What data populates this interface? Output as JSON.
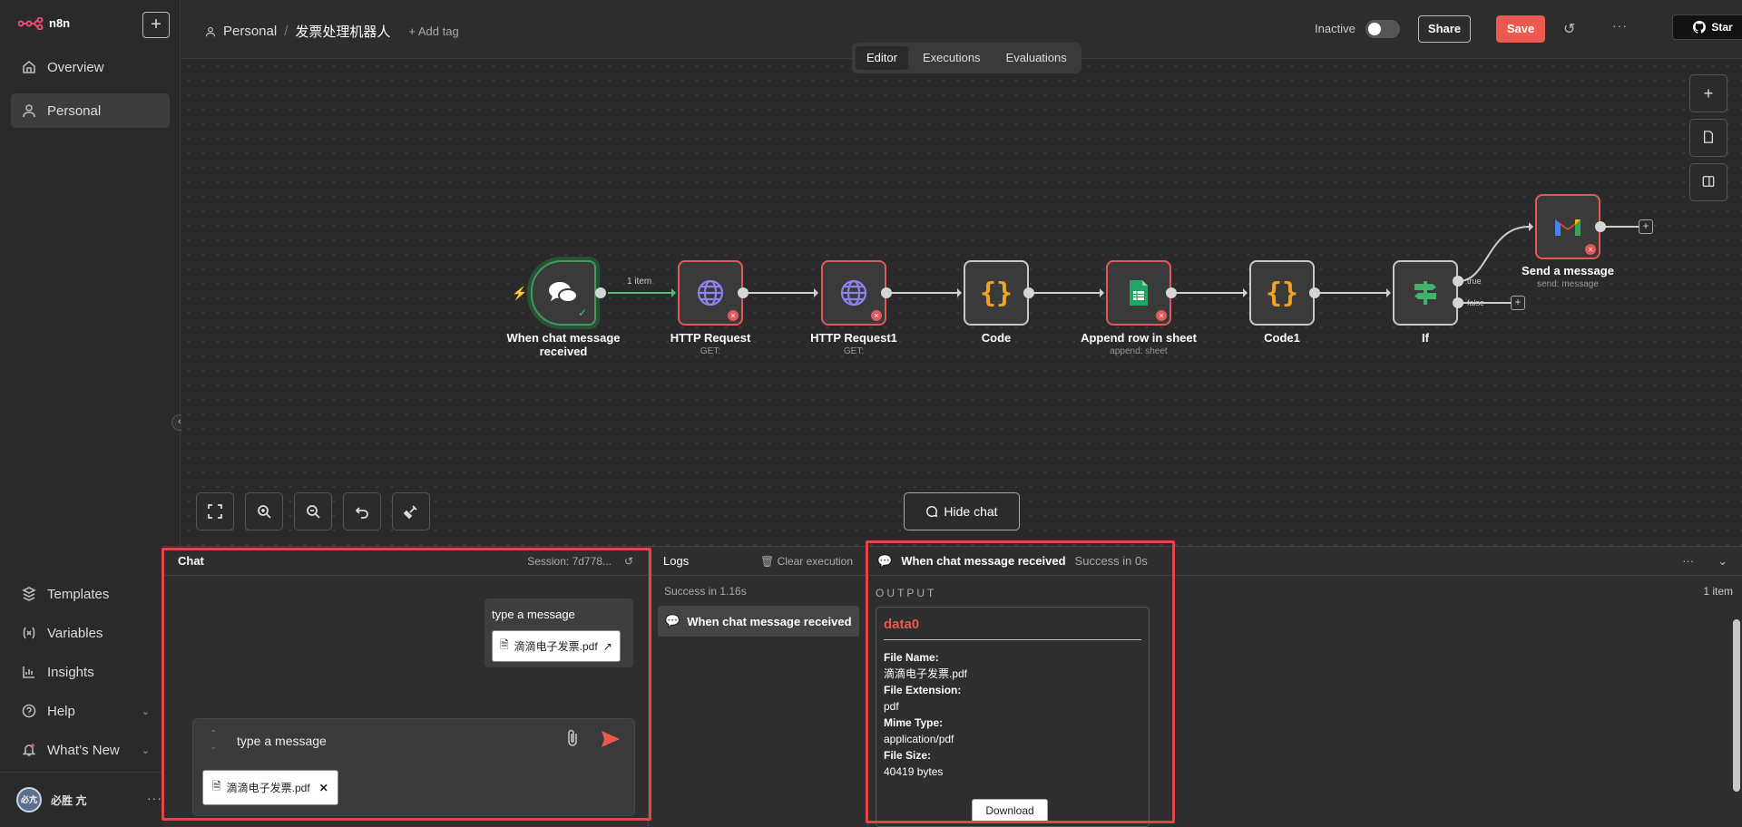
{
  "app": {
    "name": "n8n",
    "new_button": "+"
  },
  "sidebar": {
    "items": [
      {
        "label": "Overview",
        "icon": "home-icon"
      },
      {
        "label": "Personal",
        "icon": "user-icon"
      }
    ],
    "bottom_items": [
      {
        "label": "Templates",
        "icon": "templates-icon"
      },
      {
        "label": "Variables",
        "icon": "variables-icon"
      },
      {
        "label": "Insights",
        "icon": "insights-icon"
      },
      {
        "label": "Help",
        "icon": "help-icon"
      },
      {
        "label": "What’s New",
        "icon": "whats-new-icon"
      }
    ],
    "user": {
      "name": "必胜 亢",
      "avatar_text": "必亢"
    }
  },
  "header": {
    "project": "Personal",
    "workflow_name": "发票处理机器人",
    "add_tag": "+ Add tag",
    "status": "Inactive",
    "share": "Share",
    "save": "Save",
    "github": "Star"
  },
  "canvas": {
    "tabs": [
      "Editor",
      "Executions",
      "Evaluations"
    ],
    "active_tab": "Editor",
    "hide_chat": "Hide chat",
    "edge_label": "1 item",
    "branch_true": "true",
    "branch_false": "false",
    "nodes": [
      {
        "name": "When chat message received",
        "sub": ""
      },
      {
        "name": "HTTP Request",
        "sub": "GET:"
      },
      {
        "name": "HTTP Request1",
        "sub": "GET:"
      },
      {
        "name": "Code",
        "sub": ""
      },
      {
        "name": "Append row in sheet",
        "sub": "append: sheet"
      },
      {
        "name": "Code1",
        "sub": ""
      },
      {
        "name": "If",
        "sub": ""
      },
      {
        "name": "Send a message",
        "sub": "send: message"
      }
    ]
  },
  "chat": {
    "title": "Chat",
    "session": "Session: 7d778...",
    "message_text": "type a message",
    "message_file": "滴滴电子发票.pdf",
    "input_value": "type a message",
    "attached_file": "滴滴电子发票.pdf"
  },
  "logs": {
    "title": "Logs",
    "clear": "Clear execution",
    "summary": "Success in 1.16s",
    "item": "When chat message received"
  },
  "output": {
    "node": "When chat message received",
    "status": "Success in 0s",
    "heading": "OUTPUT",
    "count": "1 item",
    "data_title": "data0",
    "fields": [
      {
        "key": "File Name:",
        "value": "滴滴电子发票.pdf"
      },
      {
        "key": "File Extension:",
        "value": "pdf"
      },
      {
        "key": "Mime Type:",
        "value": "application/pdf"
      },
      {
        "key": "File Size:",
        "value": "40419 bytes"
      }
    ],
    "download": "Download"
  },
  "colors": {
    "accent": "#ea5a4f",
    "success": "#4fbf73",
    "error": "#e05a5a",
    "highlight_box": "#e04848"
  }
}
